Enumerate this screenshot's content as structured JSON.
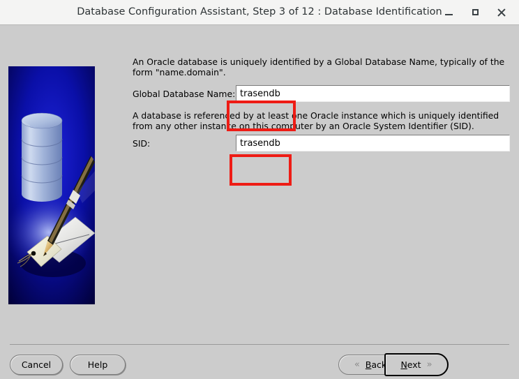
{
  "window": {
    "title": "Database Configuration Assistant, Step 3 of 12 : Database Identification",
    "controls": {
      "minimize": "minimize-icon",
      "maximize": "maximize-icon",
      "close": "close-icon"
    }
  },
  "banner": {
    "alt": "oracle-database-pen-tag-illustration",
    "background_color": "#0b0fa0"
  },
  "main": {
    "paragraph_1": "An Oracle database is uniquely identified by a Global Database Name, typically of the form \"name.domain\".",
    "paragraph_2": "A database is referenced by at least one Oracle instance which is uniquely identified from any other instance on this computer by an Oracle System Identifier (SID).",
    "global_db_name": {
      "label": "Global Database Name:",
      "value": "trasendb",
      "placeholder": ""
    },
    "sid": {
      "label": "SID:",
      "value": "trasendb",
      "placeholder": ""
    }
  },
  "annotations": {
    "color": "#ee1c15",
    "boxes": [
      {
        "name": "global-db-name-highlight",
        "target": "global_db_name"
      },
      {
        "name": "sid-highlight",
        "target": "sid"
      }
    ]
  },
  "footer": {
    "cancel_label": "Cancel",
    "help_label": "Help",
    "back": {
      "accel": "B",
      "rest": "ack",
      "chevron": "«"
    },
    "next": {
      "accel": "N",
      "rest": "ext",
      "chevron": "»"
    }
  }
}
